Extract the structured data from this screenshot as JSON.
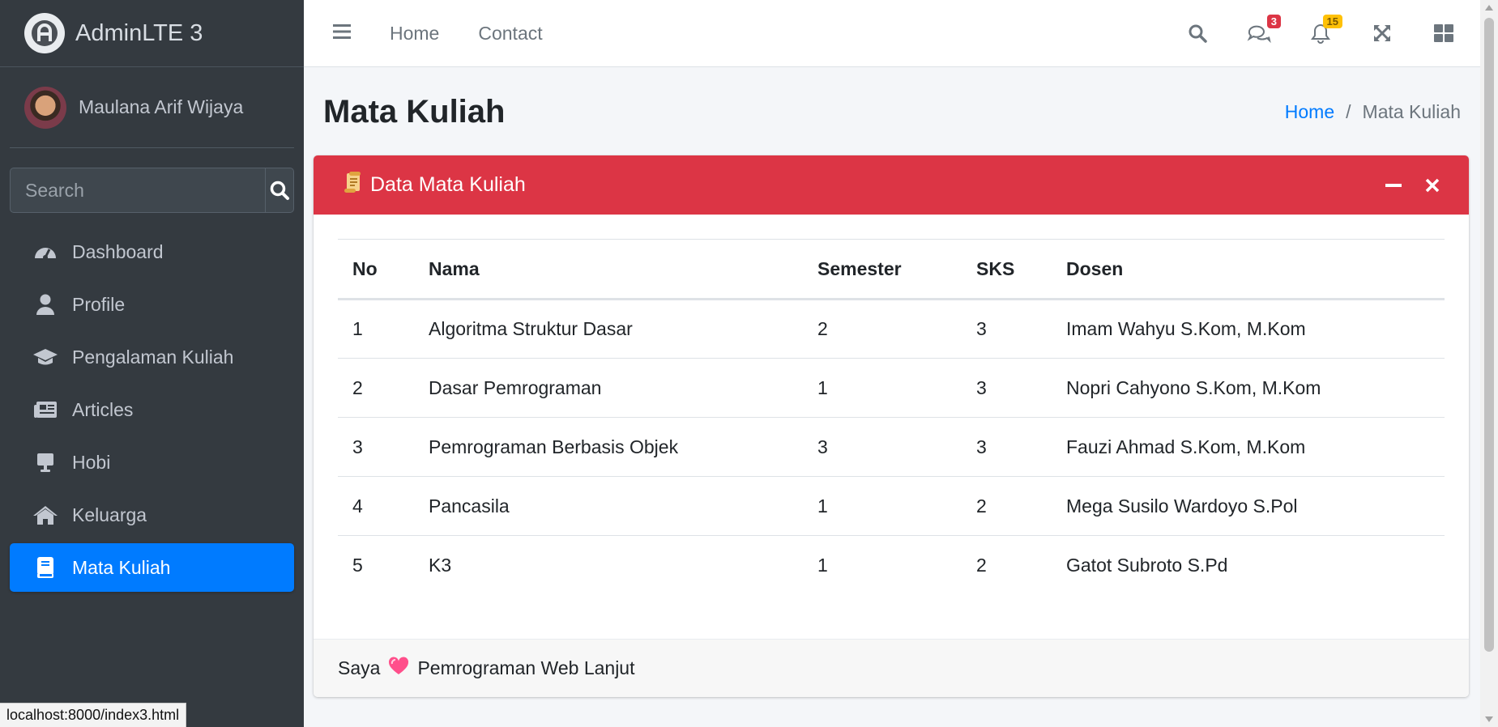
{
  "brand": {
    "name": "AdminLTE 3"
  },
  "user": {
    "name": "Maulana Arif Wijaya"
  },
  "sidebar": {
    "search_placeholder": "Search",
    "items": [
      {
        "label": "Dashboard",
        "icon": "tachometer-icon"
      },
      {
        "label": "Profile",
        "icon": "user-icon"
      },
      {
        "label": "Pengalaman Kuliah",
        "icon": "graduation-cap-icon"
      },
      {
        "label": "Articles",
        "icon": "newspaper-icon"
      },
      {
        "label": "Hobi",
        "icon": "desktop-icon"
      },
      {
        "label": "Keluarga",
        "icon": "home-icon"
      },
      {
        "label": "Mata Kuliah",
        "icon": "book-icon",
        "active": true
      }
    ]
  },
  "status_bar": {
    "url": "localhost:8000/index3.html"
  },
  "navbar": {
    "links": [
      "Home",
      "Contact"
    ],
    "messages_badge": "3",
    "notifications_badge": "15"
  },
  "header": {
    "title": "Mata Kuliah",
    "breadcrumb": {
      "home": "Home",
      "sep": "/",
      "current": "Mata Kuliah"
    }
  },
  "card": {
    "title": "Data Mata Kuliah",
    "header_color": "#dc3545",
    "columns": [
      "No",
      "Nama",
      "Semester",
      "SKS",
      "Dosen"
    ],
    "rows": [
      [
        "1",
        "Algoritma Struktur Dasar",
        "2",
        "3",
        "Imam Wahyu S.Kom, M.Kom"
      ],
      [
        "2",
        "Dasar Pemrograman",
        "1",
        "3",
        "Nopri Cahyono S.Kom, M.Kom"
      ],
      [
        "3",
        "Pemrograman Berbasis Objek",
        "3",
        "3",
        "Fauzi Ahmad S.Kom, M.Kom"
      ],
      [
        "4",
        "Pancasila",
        "1",
        "2",
        "Mega Susilo Wardoyo S.Pol"
      ],
      [
        "5",
        "K3",
        "1",
        "2",
        "Gatot Subroto S.Pd"
      ]
    ],
    "footer_before": "Saya",
    "footer_after": "Pemrograman Web Lanjut"
  },
  "colors": {
    "accent": "#007bff",
    "sidebar_bg": "#343a40",
    "danger": "#dc3545"
  }
}
